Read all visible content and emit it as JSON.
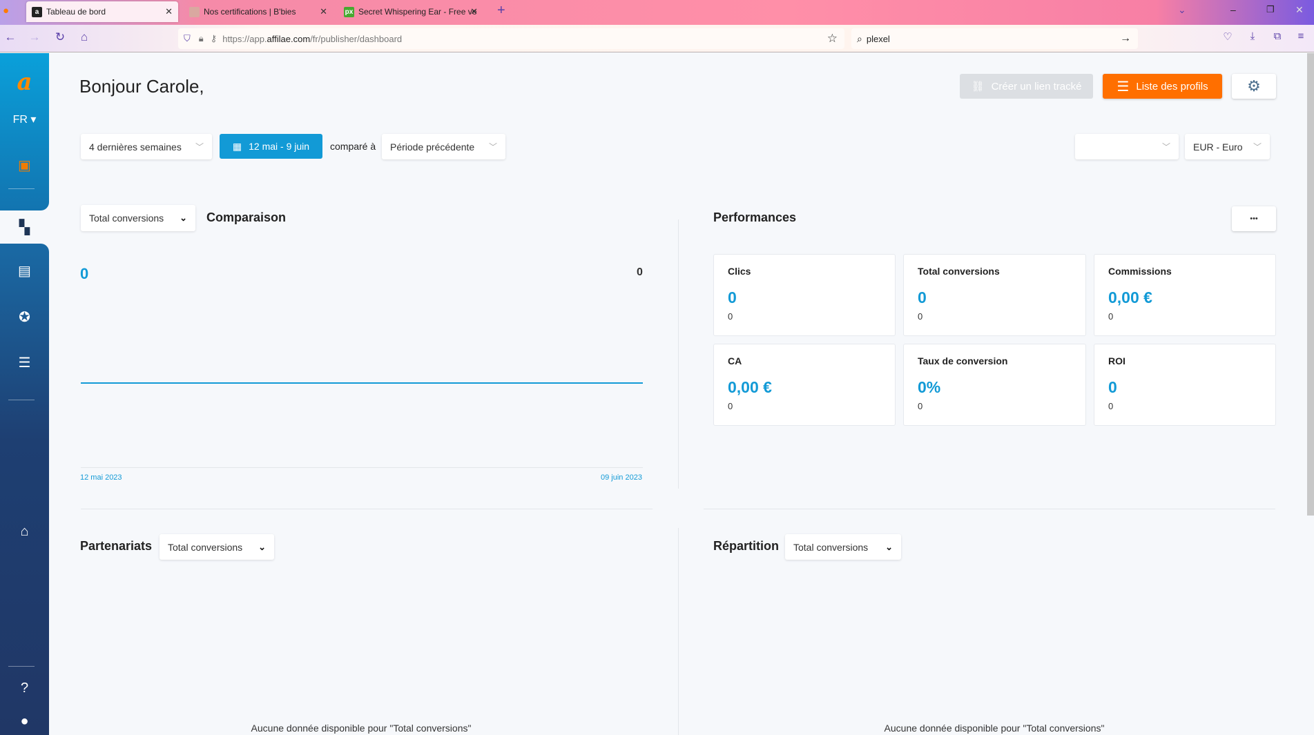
{
  "browser": {
    "tabs": [
      {
        "title": "Tableau de bord",
        "icon": "affilae-icon",
        "active": true
      },
      {
        "title": "Nos certifications | B'bies",
        "icon": "bbies-icon"
      },
      {
        "title": "Secret Whispering Ear - Free ve",
        "icon": "pixabay-icon"
      }
    ],
    "url_prefix": "https://app.",
    "url_domain": "affilae.com",
    "url_path": "/fr/publisher/dashboard",
    "search": "plexel"
  },
  "sidebar": {
    "language": "FR",
    "items": [
      "contact-card",
      "dashboard",
      "messages",
      "star",
      "list",
      "store",
      "help",
      "user"
    ],
    "accent": "#f07c00"
  },
  "header": {
    "greeting": "Bonjour Carole,",
    "create_link": "Créer un lien tracké",
    "profiles": "Liste des profils"
  },
  "filters": {
    "period": "4 dernières semaines",
    "date_range": "12 mai - 9 juin",
    "compared_label": "comparé à",
    "compare_period": "Période précédente",
    "extra_select": "",
    "currency": "EUR - Euro"
  },
  "comparison": {
    "metric": "Total conversions",
    "title": "Comparaison",
    "value_left": "0",
    "value_right": "0",
    "start_date": "12 mai 2023",
    "end_date": "09 juin 2023"
  },
  "performances": {
    "title": "Performances",
    "more": "•••",
    "cards": [
      {
        "label": "Clics",
        "value": "0",
        "previous": "0"
      },
      {
        "label": "Total conversions",
        "value": "0",
        "previous": "0"
      },
      {
        "label": "Commissions",
        "value": "0,00 €",
        "previous": "0"
      },
      {
        "label": "CA",
        "value": "0,00 €",
        "previous": "0"
      },
      {
        "label": "Taux de conversion",
        "value": "0%",
        "previous": "0"
      },
      {
        "label": "ROI",
        "value": "0",
        "previous": "0"
      }
    ]
  },
  "partnerships": {
    "title": "Partenariats",
    "metric": "Total conversions",
    "empty": "Aucune donnée disponible pour \"Total conversions\""
  },
  "distribution": {
    "title": "Répartition",
    "metric": "Total conversions",
    "empty": "Aucune donnée disponible pour \"Total conversions\""
  },
  "colors": {
    "primary": "#129ad6",
    "orange": "#ff6f00"
  }
}
